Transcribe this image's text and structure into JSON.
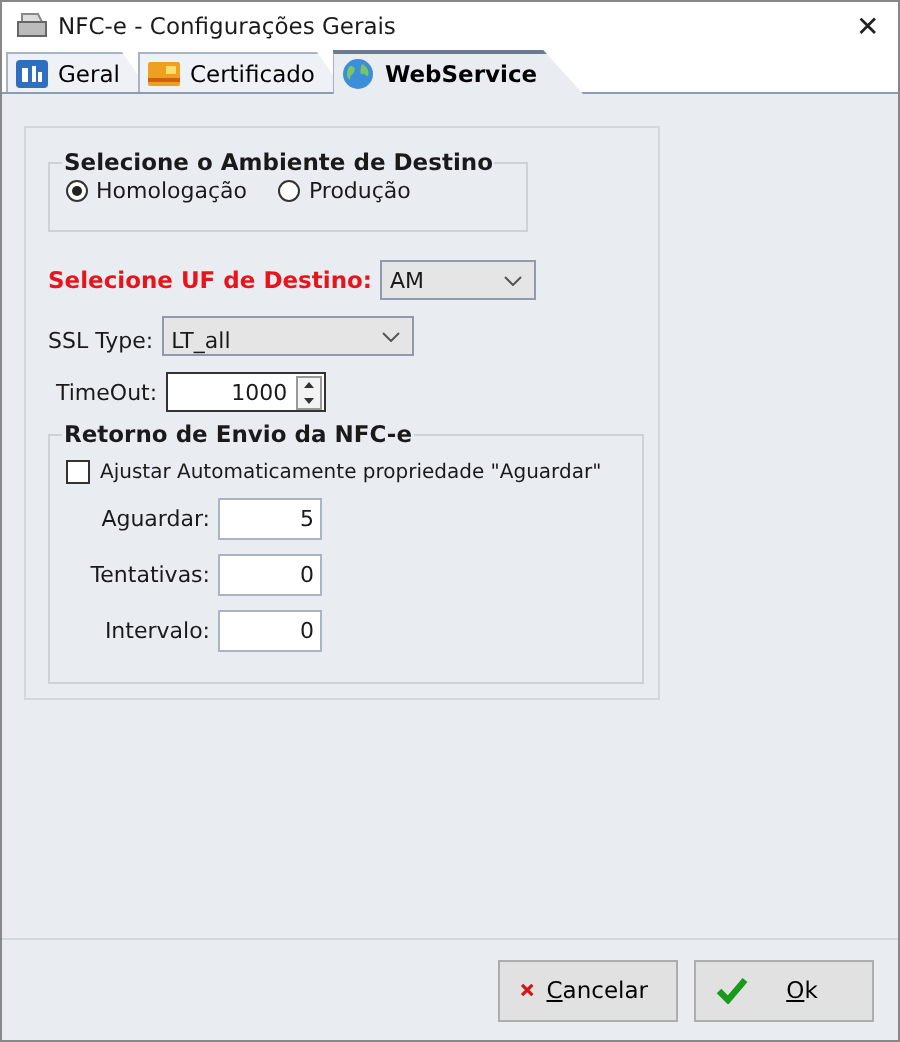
{
  "window": {
    "title": "NFC-e - Configurações Gerais",
    "close": "✕"
  },
  "tabs": [
    {
      "label": "Geral",
      "kind": "grid",
      "selected": false
    },
    {
      "label": "Certificado",
      "kind": "card",
      "selected": false
    },
    {
      "label": "WebService",
      "kind": "globe",
      "selected": true
    }
  ],
  "ambiente": {
    "title": "Selecione o Ambiente de Destino",
    "options": [
      {
        "label": "Homologação",
        "selected": true
      },
      {
        "label": "Produção",
        "selected": false
      }
    ]
  },
  "uf": {
    "label": "Selecione UF de Destino:",
    "value": "AM"
  },
  "ssl": {
    "label": "SSL Type:",
    "value": "LT_all"
  },
  "timeout": {
    "label": "TimeOut:",
    "value": "1000"
  },
  "retorno": {
    "title": "Retorno de Envio da NFC-e",
    "checkbox": {
      "label": "Ajustar Automaticamente propriedade \"Aguardar\"",
      "checked": false
    },
    "fields": [
      {
        "label": "Aguardar:",
        "value": "5"
      },
      {
        "label": "Tentativas:",
        "value": "0"
      },
      {
        "label": "Intervalo:",
        "value": "0"
      }
    ]
  },
  "buttons": [
    {
      "label": "Cancelar",
      "kind": "cancel"
    },
    {
      "label": "Ok",
      "kind": "ok"
    }
  ]
}
